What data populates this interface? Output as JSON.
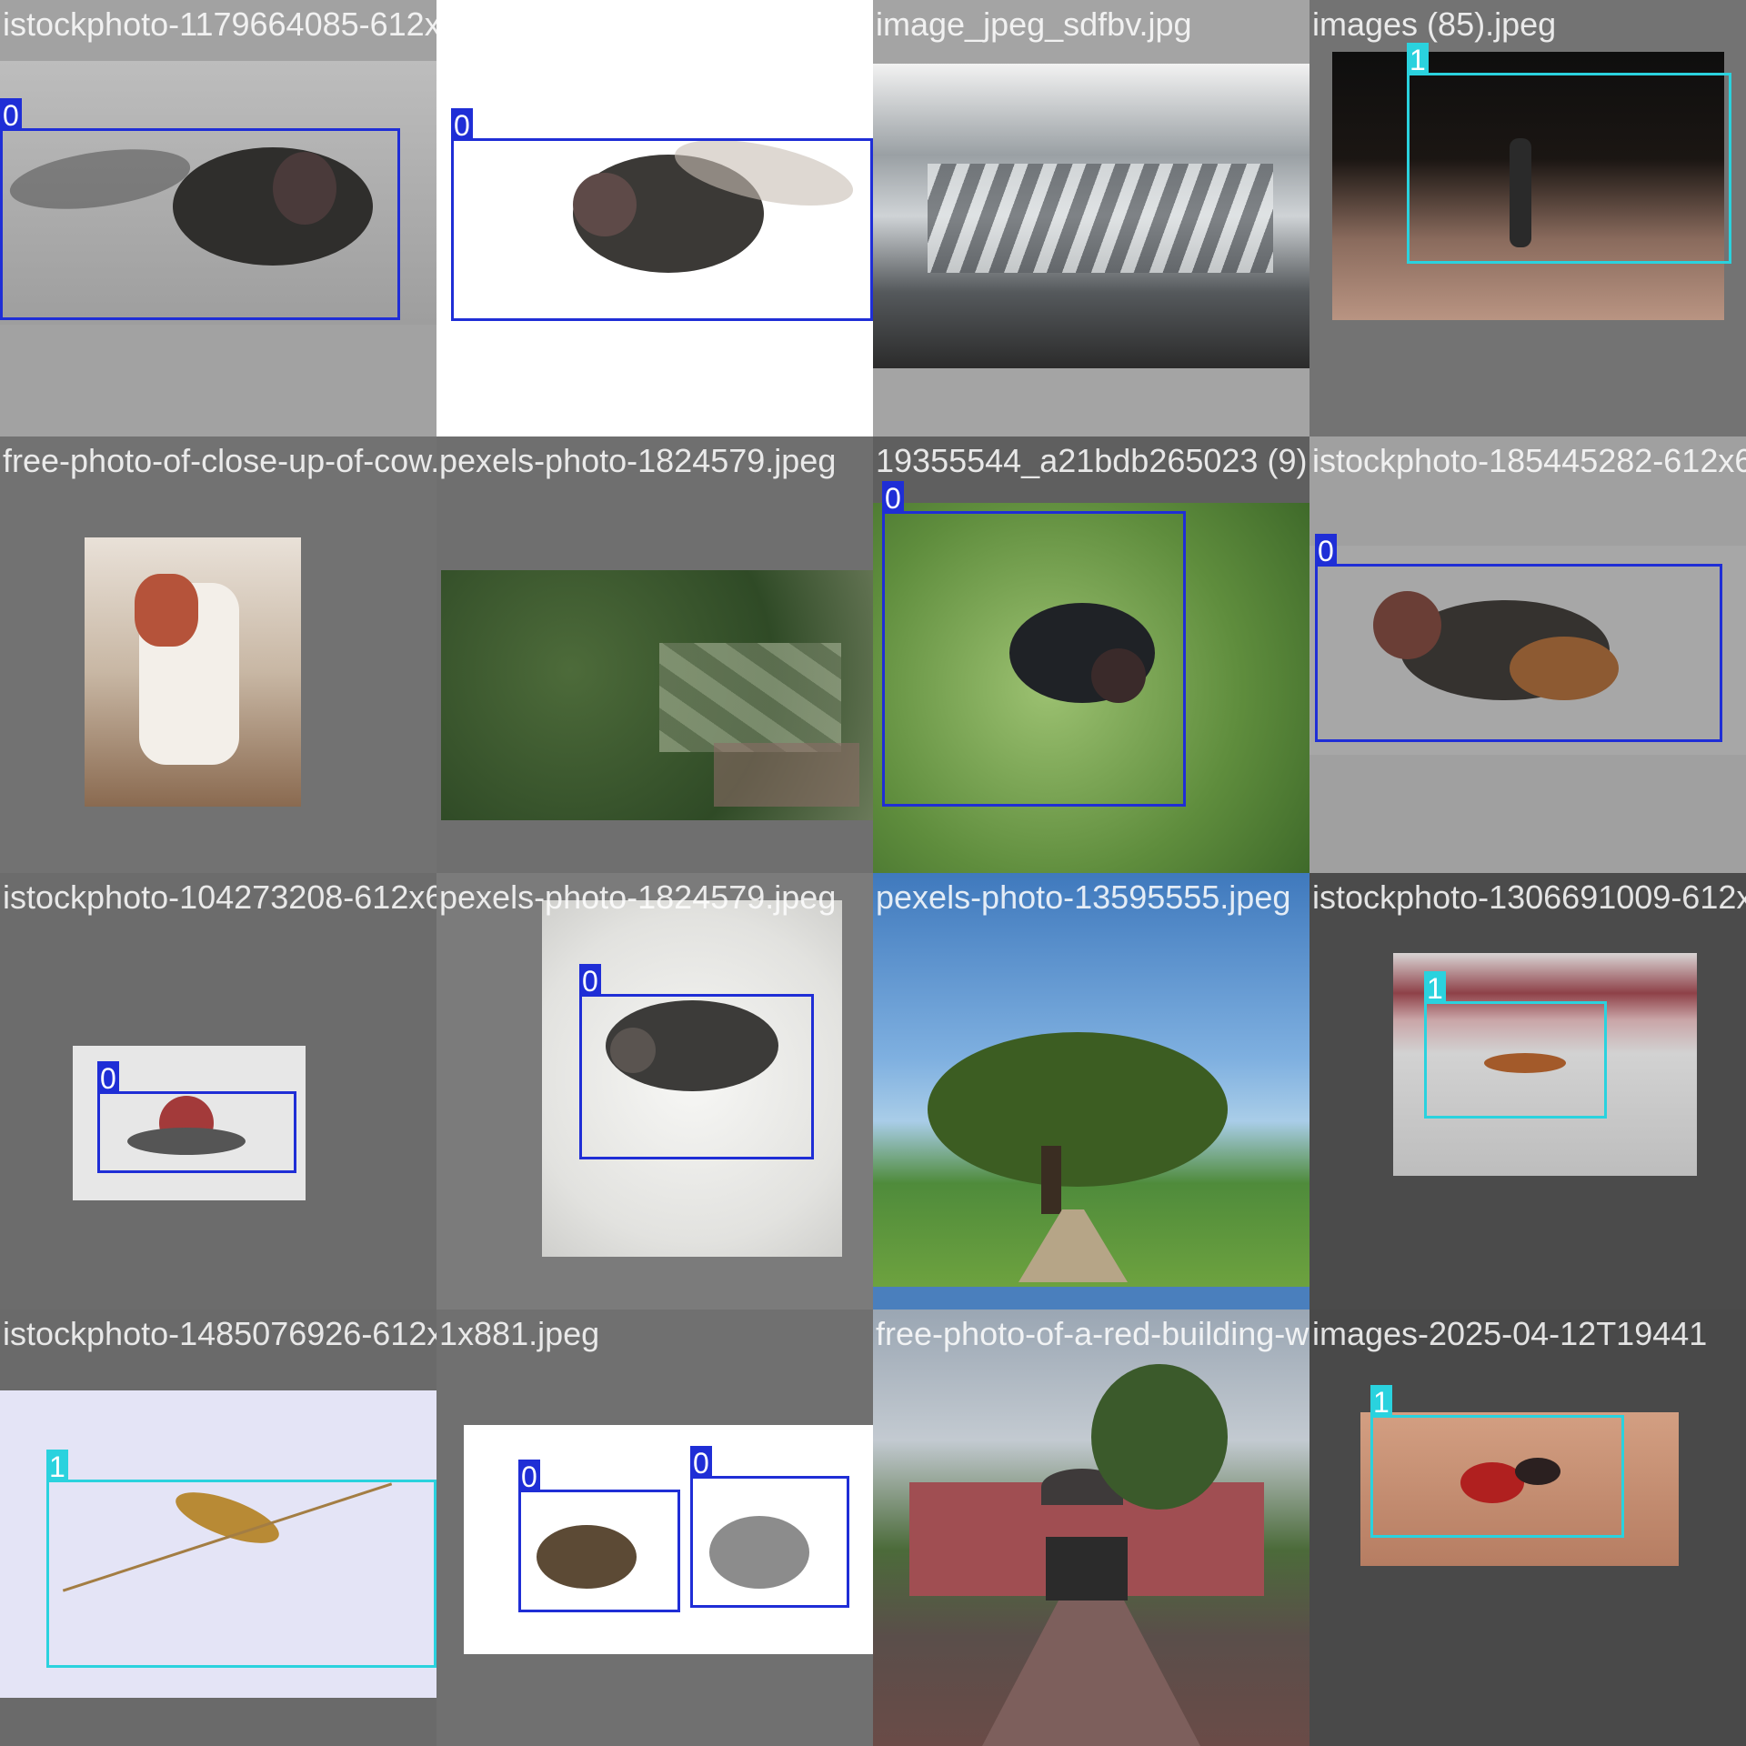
{
  "mosaic": {
    "class_colors": {
      "0": "#1f2ed6",
      "1": "#2ad2de"
    },
    "tiles": [
      {
        "filename": "istockphoto-1179664085-612x612.jpg",
        "subject": "housefly-side-view",
        "boxes": [
          {
            "label": "0"
          }
        ]
      },
      {
        "filename": "istockphoto-1313538680-612x612.jpg",
        "subject": "housefly-white-background",
        "boxes": [
          {
            "label": "0"
          }
        ]
      },
      {
        "filename": "image_jpeg_sdfbv.jpg",
        "subject": "glacier-lagoon-landscape",
        "boxes": []
      },
      {
        "filename": "images (85).jpeg",
        "subject": "mosquito-on-skin",
        "boxes": [
          {
            "label": "1"
          }
        ]
      },
      {
        "filename": "free-photo-of-close-up-of-cow.jpeg",
        "subject": "calf-standing",
        "boxes": []
      },
      {
        "filename": "pexels-photo-1824579.jpeg",
        "subject": "aerial-village-forest",
        "boxes": []
      },
      {
        "filename": "19355544_a21bdb265023 (9).jpg",
        "subject": "fly-on-green-leaf",
        "boxes": [
          {
            "label": "0"
          }
        ]
      },
      {
        "filename": "istockphoto-185445282-612x612.jpg",
        "subject": "housefly-grey-background",
        "boxes": [
          {
            "label": "0"
          }
        ]
      },
      {
        "filename": "istockphoto-104273208-612x612.jpg",
        "subject": "fly-front-view",
        "boxes": [
          {
            "label": "0"
          }
        ]
      },
      {
        "filename": "pexels-photo-1824579.jpeg",
        "subject": "fly-black-and-white",
        "boxes": [
          {
            "label": "0"
          }
        ]
      },
      {
        "filename": "pexels-photo-13595555.jpeg",
        "subject": "tree-in-rice-field",
        "boxes": []
      },
      {
        "filename": "istockphoto-1306691009-612x612.jpg",
        "subject": "mosquito-pink-background",
        "boxes": [
          {
            "label": "1"
          }
        ]
      },
      {
        "filename": "istockphoto-1485076926-612x612.jpg",
        "subject": "crane-mosquito-lavender",
        "boxes": [
          {
            "label": "1"
          }
        ]
      },
      {
        "filename": "1x881.jpeg",
        "subject": "two-flies-white-background",
        "boxes": [
          {
            "label": "0"
          },
          {
            "label": "0"
          }
        ]
      },
      {
        "filename": "free-photo-of-a-red-building-with-a-walkway.jpeg",
        "subject": "red-building-walkway",
        "boxes": []
      },
      {
        "filename": "images-2025-04-12T19441",
        "subject": "mosquito-feeding-on-skin",
        "boxes": [
          {
            "label": "1"
          }
        ]
      }
    ]
  }
}
